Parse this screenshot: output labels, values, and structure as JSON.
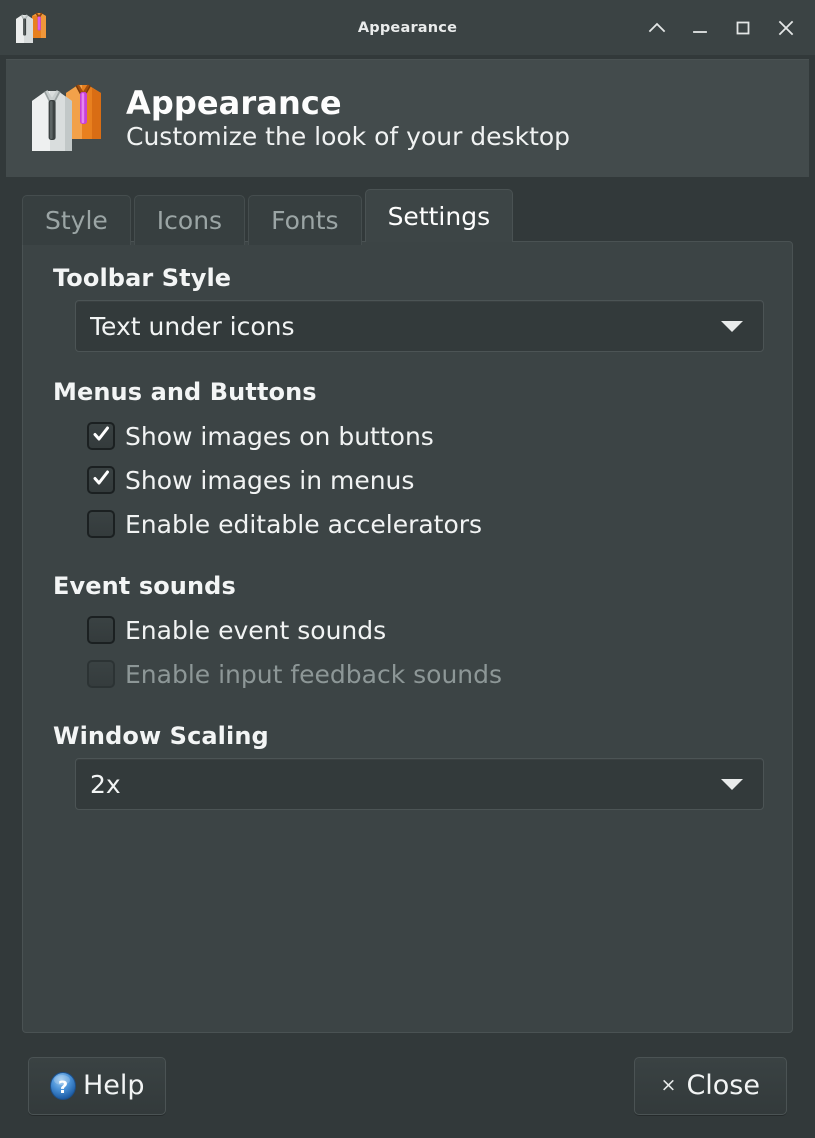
{
  "window": {
    "title": "Appearance",
    "icon": "shirts-icon",
    "titlebar_buttons": [
      {
        "name": "shade-button",
        "icon": "chevron-up-icon"
      },
      {
        "name": "minimize-button",
        "icon": "minimize-icon"
      },
      {
        "name": "maximize-button",
        "icon": "maximize-icon"
      },
      {
        "name": "close-button",
        "icon": "close-icon"
      }
    ]
  },
  "header": {
    "icon": "shirts-icon",
    "title": "Appearance",
    "subtitle": "Customize the look of your desktop"
  },
  "tabs": [
    {
      "label": "Style",
      "active": false
    },
    {
      "label": "Icons",
      "active": false
    },
    {
      "label": "Fonts",
      "active": false
    },
    {
      "label": "Settings",
      "active": true
    }
  ],
  "settings": {
    "toolbar_style": {
      "title": "Toolbar Style",
      "value": "Text under icons",
      "arrow_icon": "chevron-down-icon"
    },
    "menus_and_buttons": {
      "title": "Menus and Buttons",
      "items": [
        {
          "label": "Show images on buttons",
          "checked": true,
          "disabled": false
        },
        {
          "label": "Show images in menus",
          "checked": true,
          "disabled": false
        },
        {
          "label": "Enable editable accelerators",
          "checked": false,
          "disabled": false
        }
      ]
    },
    "event_sounds": {
      "title": "Event sounds",
      "items": [
        {
          "label": "Enable event sounds",
          "checked": false,
          "disabled": false
        },
        {
          "label": "Enable input feedback sounds",
          "checked": false,
          "disabled": true
        }
      ]
    },
    "window_scaling": {
      "title": "Window Scaling",
      "value": "2x",
      "arrow_icon": "chevron-down-icon"
    }
  },
  "actions": {
    "help_label": "Help",
    "help_icon": "help-circle-icon",
    "close_label": "Close",
    "close_icon": "close-x-icon"
  },
  "colors": {
    "window_bg": "#32393a",
    "titlebar_bg": "#3b4344",
    "header_bg": "#434b4c",
    "panel_bg": "#3c4445",
    "text": "#f1f3f3",
    "text_muted": "#9ba5a5",
    "help_blue": "#3a86d0"
  }
}
